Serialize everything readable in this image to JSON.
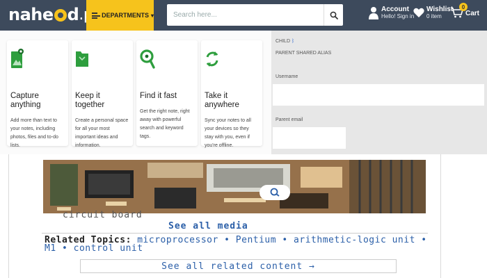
{
  "header": {
    "logo_text_a": "nahe",
    "logo_text_b": "d",
    "logo_text_c": ".pk",
    "departments_label": "DEPARTMENTS",
    "search_placeholder": "Search here...",
    "account_title": "Account",
    "account_sub": "Hello! Sign in",
    "wishlist_title": "Wishlist",
    "wishlist_sub": "0 item",
    "cart_label": "Cart",
    "cart_count": "0"
  },
  "features": [
    {
      "title": "Capture anything",
      "desc": "Add more than text to your notes, including photos, files and to-do lists.",
      "icon": "photo-note-icon",
      "color": "#2e9e3e"
    },
    {
      "title": "Keep it together",
      "desc": "Create a personal space for all your most important ideas and information.",
      "icon": "folder-icon",
      "color": "#2e9e3e"
    },
    {
      "title": "Find it fast",
      "desc": "Get the right note, right away with powerful search and keyword tags.",
      "icon": "search-icon",
      "color": "#2e9e3e"
    },
    {
      "title": "Take it anywhere",
      "desc": "Sync your notes to all your devices so they stay with you, even if you're offline.",
      "icon": "sync-icon",
      "color": "#2e9e3e"
    }
  ],
  "form_panel": {
    "child_label": "CHILD",
    "parent_label": "PARENT SHARED ALIAS",
    "username_label": "Username",
    "parent_email_label": "Parent email"
  },
  "article": {
    "caption": "circuit board",
    "see_media": "See all media",
    "related_label": "Related Topics:",
    "related_links": "microprocessor • Pentium • arithmetic-logic unit • M1 • control unit",
    "see_related": "See all related content →"
  },
  "colors": {
    "header_bg": "#3d4a5c",
    "accent_yellow": "#f6c31c",
    "link_blue": "#2b5fa8",
    "feature_green": "#2e9e3e"
  }
}
